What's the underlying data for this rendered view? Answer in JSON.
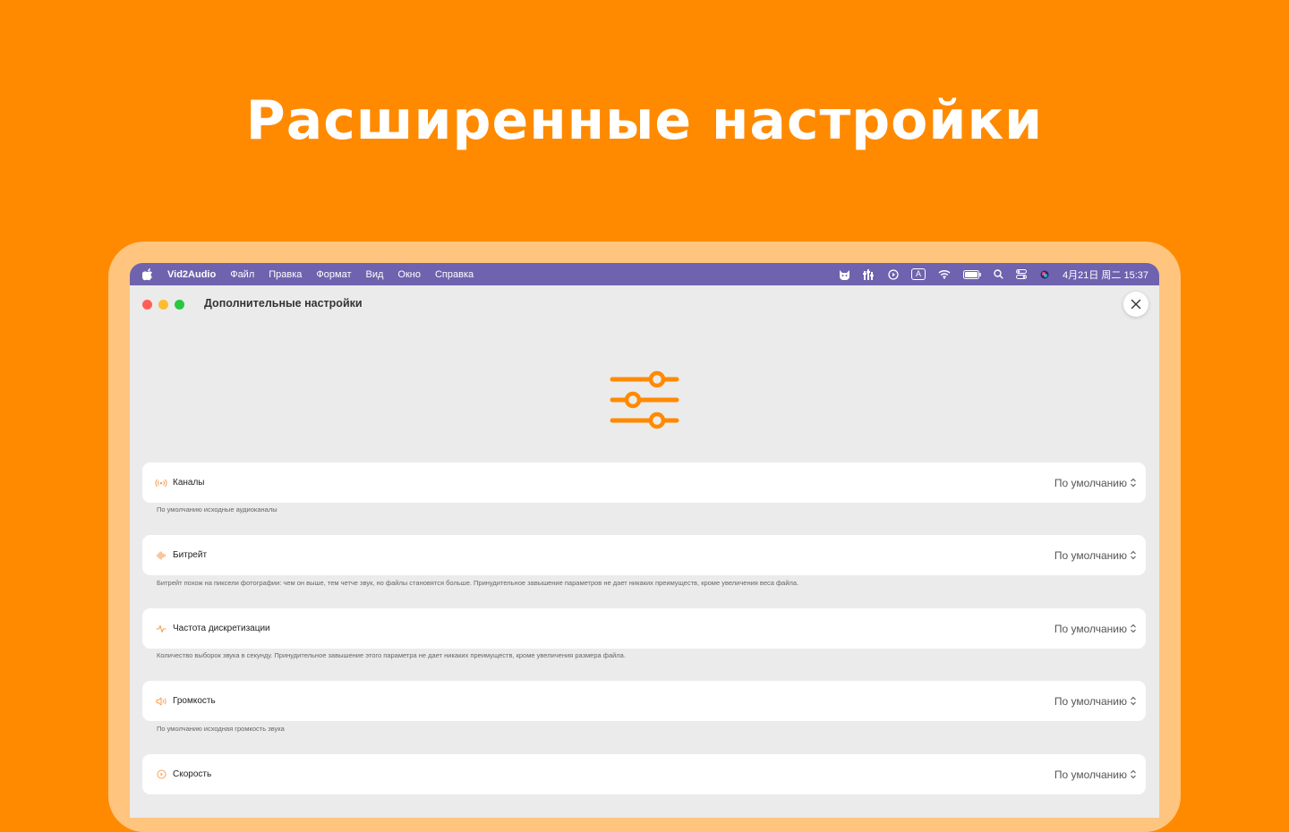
{
  "headline": "Расширенные настройки",
  "menubar": {
    "app_name": "Vid2Audio",
    "items": [
      "Файл",
      "Правка",
      "Формат",
      "Вид",
      "Окно",
      "Справка"
    ],
    "input_indicator": "A",
    "clock": "4月21日 周二 15:37"
  },
  "window": {
    "title": "Дополнительные настройки"
  },
  "settings": [
    {
      "label": "Каналы",
      "value": "По умолчанию",
      "icon": "channels-icon",
      "description": "По умолчанию исходные аудиоканалы"
    },
    {
      "label": "Битрейт",
      "value": "По умолчанию",
      "icon": "waveform-icon",
      "description": "Битрейт похож на пиксели фотографии: чем он выше, тем четче звук, но файлы становятся больше. Принудительное завышение параметров не дает никаких преимуществ, кроме увеличения веса файла."
    },
    {
      "label": "Частота дискретизации",
      "value": "По умолчанию",
      "icon": "pulse-icon",
      "description": "Количество выборок звука в секунду. Принудительное завышение этого параметра не дает никаких преимуществ, кроме увеличения размера файла."
    },
    {
      "label": "Громкость",
      "value": "По умолчанию",
      "icon": "speaker-icon",
      "description": "По умолчанию исходная громкость звука"
    },
    {
      "label": "Скорость",
      "value": "По умолчанию",
      "icon": "speed-icon",
      "description": ""
    }
  ],
  "colors": {
    "accent": "#FF8A00",
    "menubar": "#6F62AE",
    "frame": "#FFC57E",
    "window_bg": "#EBEBEB"
  }
}
